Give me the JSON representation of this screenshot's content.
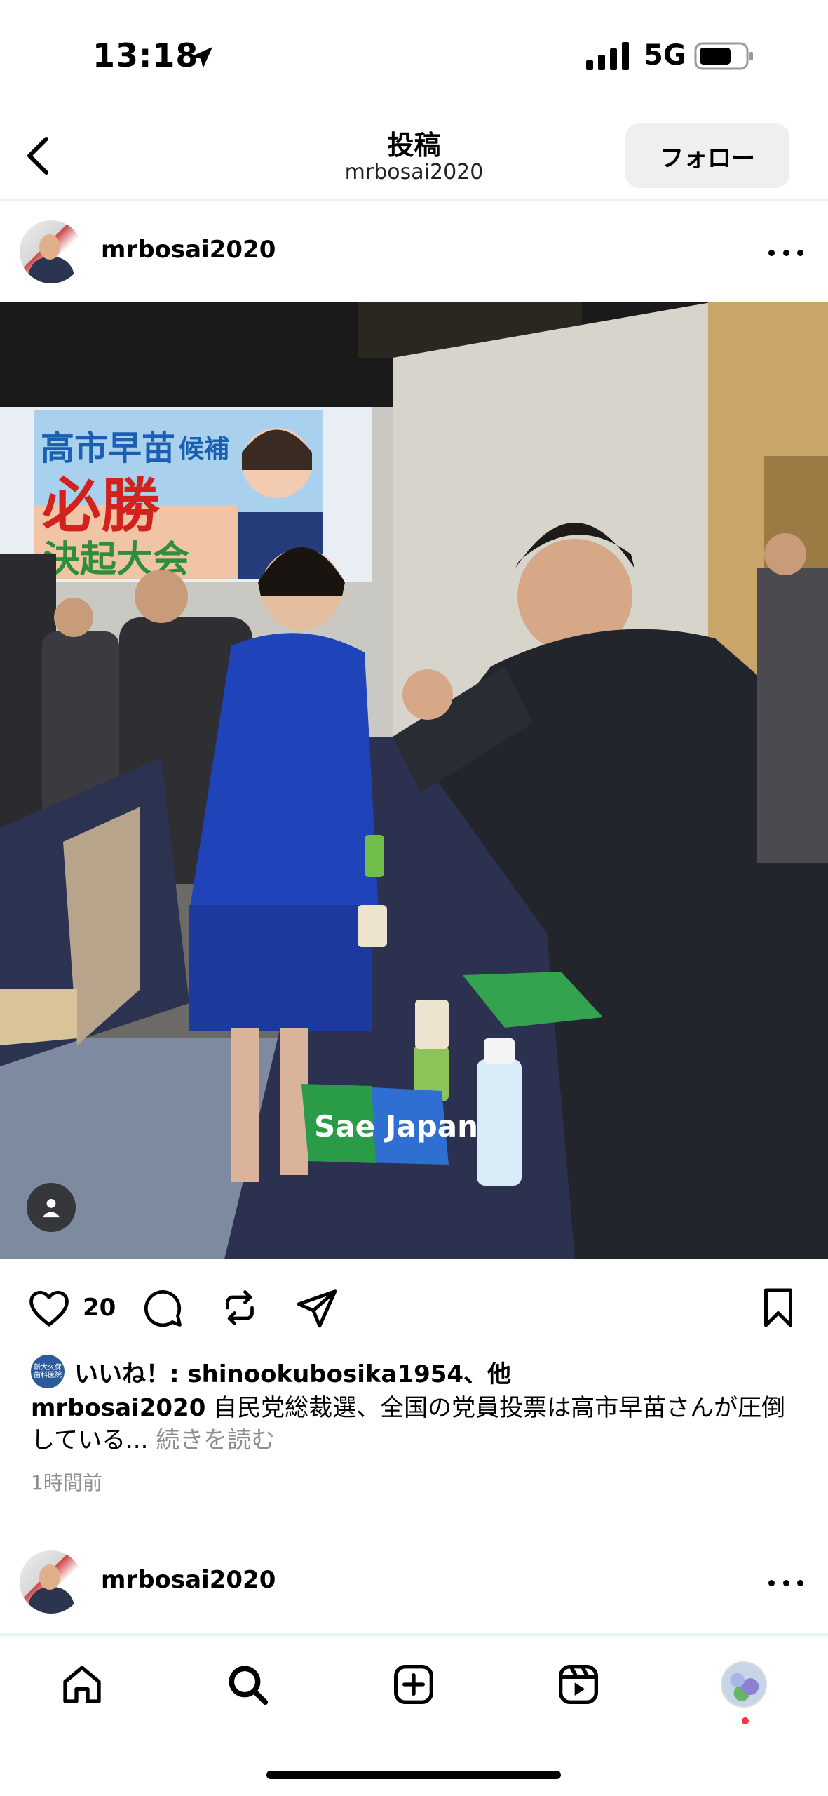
{
  "status_bar": {
    "time": "13:18",
    "network": "5G",
    "icons": [
      "location-arrow-icon",
      "signal-bars-icon",
      "battery-icon"
    ]
  },
  "header": {
    "title": "投稿",
    "subtitle": "mrbosai2020",
    "follow_label": "フォロー"
  },
  "post": {
    "username": "mrbosai2020",
    "photo_sign": {
      "line1": "高市早苗",
      "line1_suffix": "候補",
      "line2": "必勝",
      "line3": "決起大会",
      "towel_text": "Sae  Japan"
    },
    "like_count": "20",
    "likes_avatar_text": "新大久保 歯科医院",
    "likes_text": "いいね！: shinookubosika1954、他",
    "caption_user": "mrbosai2020",
    "caption_text": " 自民党総裁選、全国の党員投票は高市早苗さんが圧倒している...",
    "caption_more": " 続きを読む",
    "timestamp": "1時間前"
  },
  "next_post": {
    "username": "mrbosai2020"
  },
  "colors": {
    "follow_bg": "#efefef",
    "muted_text": "#8e8e8e",
    "notification": "#ff3040"
  }
}
